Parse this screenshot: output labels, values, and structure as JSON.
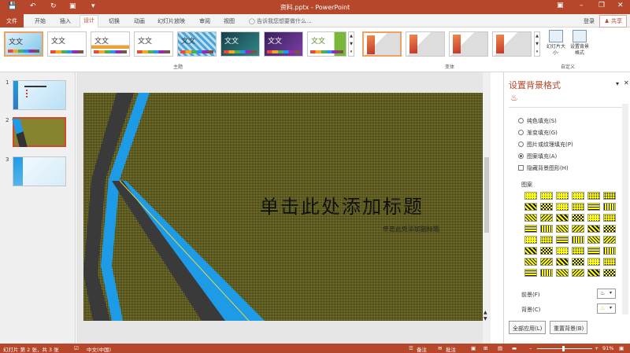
{
  "window": {
    "title": "资料.pptx - PowerPoint",
    "signin": "登录",
    "share": "共享"
  },
  "tabs": [
    "文件",
    "开始",
    "插入",
    "设计",
    "切换",
    "动画",
    "幻灯片放映",
    "审阅",
    "视图"
  ],
  "tell_me": "告诉我您想要做什么...",
  "ribbon": {
    "themes": [
      "文文",
      "文文",
      "文文",
      "文文",
      "文文",
      "文文",
      "文文",
      "文文"
    ],
    "theme_label": "文文",
    "theme_group": "主题",
    "variant_group": "变体",
    "customize_group": "自定义",
    "slide_size": "幻灯片大小·",
    "format_bg": "设置背景格式"
  },
  "thumbnails": [
    {
      "num": "1"
    },
    {
      "num": "2"
    },
    {
      "num": "3"
    }
  ],
  "slide": {
    "title": "单击此处添加标题",
    "subtitle": "单击此处添加副标题"
  },
  "pane": {
    "title": "设置背景格式",
    "fill_options": [
      {
        "label": "纯色填充(S)",
        "selected": false
      },
      {
        "label": "渐变填充(G)",
        "selected": false
      },
      {
        "label": "图片或纹理填充(P)",
        "selected": false
      },
      {
        "label": "图案填充(A)",
        "selected": true
      }
    ],
    "hide_bg_graphics": "隐藏背景图形(H)",
    "pattern_label": "图案",
    "foreground_label": "前景(F)",
    "background_label": "背景(C)",
    "apply_all": "全部应用(L)",
    "reset_bg": "重置背景(B)",
    "colors": {
      "pattern_fg": "#1a1a1a",
      "pattern_bg": "#ffff00"
    }
  },
  "status": {
    "slide_info": "幻灯片 第 2 张，共 3 张",
    "language": "中文(中国)",
    "notes": "备注",
    "comments": "批注",
    "zoom": "91%"
  },
  "colors": {
    "accent": "#b7472a",
    "slide_bg": "#86832f",
    "shape_blue": "#1e9be6",
    "shape_dark": "#3a3a3a"
  }
}
